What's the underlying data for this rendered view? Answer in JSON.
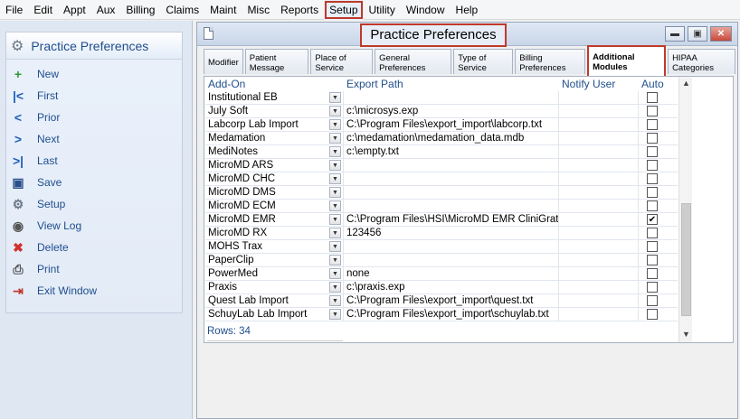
{
  "menu": [
    "File",
    "Edit",
    "Appt",
    "Aux",
    "Billing",
    "Claims",
    "Maint",
    "Misc",
    "Reports",
    "Setup",
    "Utility",
    "Window",
    "Help"
  ],
  "left_panel": {
    "title": "Practice Preferences",
    "items": [
      {
        "label": "New",
        "icon": "new-icon",
        "glyph": "+",
        "color": "#2e9b3a"
      },
      {
        "label": "First",
        "icon": "first-icon",
        "glyph": "|<",
        "color": "#1f5fb8"
      },
      {
        "label": "Prior",
        "icon": "prior-icon",
        "glyph": "<",
        "color": "#1f5fb8"
      },
      {
        "label": "Next",
        "icon": "next-icon",
        "glyph": ">",
        "color": "#1f5fb8"
      },
      {
        "label": "Last",
        "icon": "last-icon",
        "glyph": ">|",
        "color": "#1f5fb8"
      },
      {
        "label": "Save",
        "icon": "save-icon",
        "glyph": "▣",
        "color": "#2a4f8a"
      },
      {
        "label": "Setup",
        "icon": "setup-icon",
        "glyph": "⚙",
        "color": "#6b7787"
      },
      {
        "label": "View Log",
        "icon": "view-log-icon",
        "glyph": "◉",
        "color": "#555"
      },
      {
        "label": "Delete",
        "icon": "delete-icon",
        "glyph": "✖",
        "color": "#d0322b"
      },
      {
        "label": "Print",
        "icon": "print-icon",
        "glyph": "⎙",
        "color": "#555"
      },
      {
        "label": "Exit Window",
        "icon": "exit-window-icon",
        "glyph": "⇥",
        "color": "#c0392b"
      }
    ]
  },
  "window": {
    "title": "Practice Preferences",
    "tabs": [
      {
        "label": "Modifier"
      },
      {
        "label": "Patient Message"
      },
      {
        "label": "Place of Service"
      },
      {
        "label": "General Preferences"
      },
      {
        "label": "Type of Service"
      },
      {
        "label": "Billing Preferences"
      },
      {
        "label": "Additional Modules",
        "active": true
      },
      {
        "label": "HIPAA Categories"
      }
    ],
    "columns": {
      "addon": "Add-On",
      "path": "Export Path",
      "notify": "Notify User",
      "auto": "Auto"
    },
    "rows": [
      {
        "addon": "Institutional EB",
        "path": "",
        "auto": false
      },
      {
        "addon": "July Soft",
        "path": "c:\\microsys.exp",
        "auto": false
      },
      {
        "addon": "Labcorp Lab Import",
        "path": "C:\\Program Files\\export_import\\labcorp.txt",
        "auto": false
      },
      {
        "addon": "Medamation",
        "path": "c:\\medamation\\medamation_data.mdb",
        "auto": false
      },
      {
        "addon": "MediNotes",
        "path": "c:\\empty.txt",
        "auto": false
      },
      {
        "addon": "MicroMD ARS",
        "path": "",
        "auto": false
      },
      {
        "addon": "MicroMD CHC",
        "path": "",
        "auto": false
      },
      {
        "addon": "MicroMD DMS",
        "path": "",
        "auto": false
      },
      {
        "addon": "MicroMD ECM",
        "path": "",
        "auto": false
      },
      {
        "addon": "MicroMD EMR",
        "path": "C:\\Program Files\\HSI\\MicroMD EMR CliniGratic",
        "auto": true
      },
      {
        "addon": "MicroMD RX",
        "path": "123456",
        "auto": false
      },
      {
        "addon": "MOHS Trax",
        "path": "",
        "auto": false
      },
      {
        "addon": "PaperClip",
        "path": "",
        "auto": false
      },
      {
        "addon": "PowerMed",
        "path": "none",
        "auto": false
      },
      {
        "addon": "Praxis",
        "path": "c:\\praxis.exp",
        "auto": false
      },
      {
        "addon": "Quest Lab Import",
        "path": "C:\\Program Files\\export_import\\quest.txt",
        "auto": false
      },
      {
        "addon": "SchuyLab Lab Import",
        "path": "C:\\Program Files\\export_import\\schuylab.txt",
        "auto": false
      }
    ],
    "rows_count": "Rows: 34"
  }
}
